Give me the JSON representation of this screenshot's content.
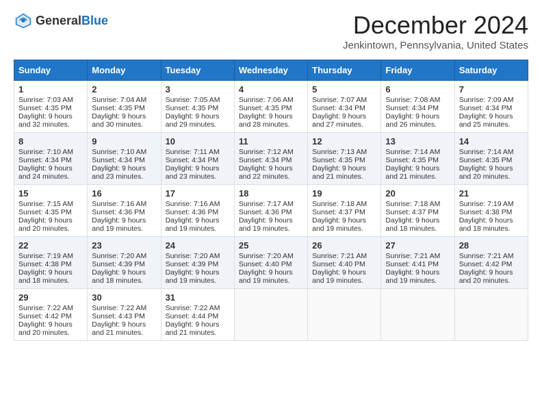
{
  "logo": {
    "general": "General",
    "blue": "Blue"
  },
  "title": "December 2024",
  "subtitle": "Jenkintown, Pennsylvania, United States",
  "days_of_week": [
    "Sunday",
    "Monday",
    "Tuesday",
    "Wednesday",
    "Thursday",
    "Friday",
    "Saturday"
  ],
  "weeks": [
    [
      {
        "day": "1",
        "sunrise": "Sunrise: 7:03 AM",
        "sunset": "Sunset: 4:35 PM",
        "daylight": "Daylight: 9 hours and 32 minutes."
      },
      {
        "day": "2",
        "sunrise": "Sunrise: 7:04 AM",
        "sunset": "Sunset: 4:35 PM",
        "daylight": "Daylight: 9 hours and 30 minutes."
      },
      {
        "day": "3",
        "sunrise": "Sunrise: 7:05 AM",
        "sunset": "Sunset: 4:35 PM",
        "daylight": "Daylight: 9 hours and 29 minutes."
      },
      {
        "day": "4",
        "sunrise": "Sunrise: 7:06 AM",
        "sunset": "Sunset: 4:35 PM",
        "daylight": "Daylight: 9 hours and 28 minutes."
      },
      {
        "day": "5",
        "sunrise": "Sunrise: 7:07 AM",
        "sunset": "Sunset: 4:34 PM",
        "daylight": "Daylight: 9 hours and 27 minutes."
      },
      {
        "day": "6",
        "sunrise": "Sunrise: 7:08 AM",
        "sunset": "Sunset: 4:34 PM",
        "daylight": "Daylight: 9 hours and 26 minutes."
      },
      {
        "day": "7",
        "sunrise": "Sunrise: 7:09 AM",
        "sunset": "Sunset: 4:34 PM",
        "daylight": "Daylight: 9 hours and 25 minutes."
      }
    ],
    [
      {
        "day": "8",
        "sunrise": "Sunrise: 7:10 AM",
        "sunset": "Sunset: 4:34 PM",
        "daylight": "Daylight: 9 hours and 24 minutes."
      },
      {
        "day": "9",
        "sunrise": "Sunrise: 7:10 AM",
        "sunset": "Sunset: 4:34 PM",
        "daylight": "Daylight: 9 hours and 23 minutes."
      },
      {
        "day": "10",
        "sunrise": "Sunrise: 7:11 AM",
        "sunset": "Sunset: 4:34 PM",
        "daylight": "Daylight: 9 hours and 23 minutes."
      },
      {
        "day": "11",
        "sunrise": "Sunrise: 7:12 AM",
        "sunset": "Sunset: 4:34 PM",
        "daylight": "Daylight: 9 hours and 22 minutes."
      },
      {
        "day": "12",
        "sunrise": "Sunrise: 7:13 AM",
        "sunset": "Sunset: 4:35 PM",
        "daylight": "Daylight: 9 hours and 21 minutes."
      },
      {
        "day": "13",
        "sunrise": "Sunrise: 7:14 AM",
        "sunset": "Sunset: 4:35 PM",
        "daylight": "Daylight: 9 hours and 21 minutes."
      },
      {
        "day": "14",
        "sunrise": "Sunrise: 7:14 AM",
        "sunset": "Sunset: 4:35 PM",
        "daylight": "Daylight: 9 hours and 20 minutes."
      }
    ],
    [
      {
        "day": "15",
        "sunrise": "Sunrise: 7:15 AM",
        "sunset": "Sunset: 4:35 PM",
        "daylight": "Daylight: 9 hours and 20 minutes."
      },
      {
        "day": "16",
        "sunrise": "Sunrise: 7:16 AM",
        "sunset": "Sunset: 4:36 PM",
        "daylight": "Daylight: 9 hours and 19 minutes."
      },
      {
        "day": "17",
        "sunrise": "Sunrise: 7:16 AM",
        "sunset": "Sunset: 4:36 PM",
        "daylight": "Daylight: 9 hours and 19 minutes."
      },
      {
        "day": "18",
        "sunrise": "Sunrise: 7:17 AM",
        "sunset": "Sunset: 4:36 PM",
        "daylight": "Daylight: 9 hours and 19 minutes."
      },
      {
        "day": "19",
        "sunrise": "Sunrise: 7:18 AM",
        "sunset": "Sunset: 4:37 PM",
        "daylight": "Daylight: 9 hours and 19 minutes."
      },
      {
        "day": "20",
        "sunrise": "Sunrise: 7:18 AM",
        "sunset": "Sunset: 4:37 PM",
        "daylight": "Daylight: 9 hours and 18 minutes."
      },
      {
        "day": "21",
        "sunrise": "Sunrise: 7:19 AM",
        "sunset": "Sunset: 4:38 PM",
        "daylight": "Daylight: 9 hours and 18 minutes."
      }
    ],
    [
      {
        "day": "22",
        "sunrise": "Sunrise: 7:19 AM",
        "sunset": "Sunset: 4:38 PM",
        "daylight": "Daylight: 9 hours and 18 minutes."
      },
      {
        "day": "23",
        "sunrise": "Sunrise: 7:20 AM",
        "sunset": "Sunset: 4:39 PM",
        "daylight": "Daylight: 9 hours and 18 minutes."
      },
      {
        "day": "24",
        "sunrise": "Sunrise: 7:20 AM",
        "sunset": "Sunset: 4:39 PM",
        "daylight": "Daylight: 9 hours and 19 minutes."
      },
      {
        "day": "25",
        "sunrise": "Sunrise: 7:20 AM",
        "sunset": "Sunset: 4:40 PM",
        "daylight": "Daylight: 9 hours and 19 minutes."
      },
      {
        "day": "26",
        "sunrise": "Sunrise: 7:21 AM",
        "sunset": "Sunset: 4:40 PM",
        "daylight": "Daylight: 9 hours and 19 minutes."
      },
      {
        "day": "27",
        "sunrise": "Sunrise: 7:21 AM",
        "sunset": "Sunset: 4:41 PM",
        "daylight": "Daylight: 9 hours and 19 minutes."
      },
      {
        "day": "28",
        "sunrise": "Sunrise: 7:21 AM",
        "sunset": "Sunset: 4:42 PM",
        "daylight": "Daylight: 9 hours and 20 minutes."
      }
    ],
    [
      {
        "day": "29",
        "sunrise": "Sunrise: 7:22 AM",
        "sunset": "Sunset: 4:42 PM",
        "daylight": "Daylight: 9 hours and 20 minutes."
      },
      {
        "day": "30",
        "sunrise": "Sunrise: 7:22 AM",
        "sunset": "Sunset: 4:43 PM",
        "daylight": "Daylight: 9 hours and 21 minutes."
      },
      {
        "day": "31",
        "sunrise": "Sunrise: 7:22 AM",
        "sunset": "Sunset: 4:44 PM",
        "daylight": "Daylight: 9 hours and 21 minutes."
      },
      null,
      null,
      null,
      null
    ]
  ]
}
